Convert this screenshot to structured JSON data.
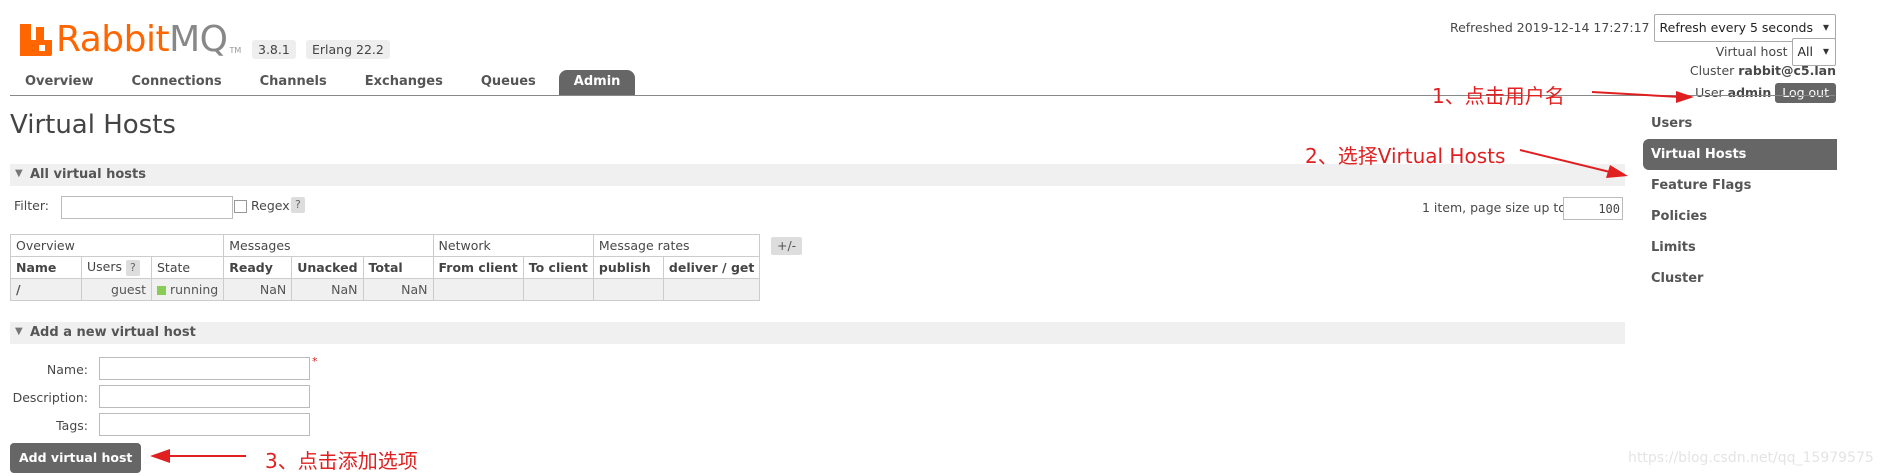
{
  "header": {
    "logo_brand": "Rabbit",
    "logo_mq": "MQ",
    "trademark": "TM",
    "version": "3.8.1",
    "erlang": "Erlang 22.2",
    "refreshed": "Refreshed 2019-12-14 17:27:17",
    "refresh_select": "Refresh every 5 seconds",
    "vhost_label": "Virtual host",
    "vhost_select": "All",
    "cluster_label": "Cluster",
    "cluster_name": "rabbit@c5.lan",
    "user_label": "User",
    "user_name": "admin",
    "logout_label": "Log out"
  },
  "tabs": [
    "Overview",
    "Connections",
    "Channels",
    "Exchanges",
    "Queues",
    "Admin"
  ],
  "right_menu": [
    "Users",
    "Virtual Hosts",
    "Feature Flags",
    "Policies",
    "Limits",
    "Cluster"
  ],
  "main": {
    "title": "Virtual Hosts",
    "section_all": "All virtual hosts",
    "filter_label": "Filter:",
    "regex_label": "Regex",
    "help_mark": "?",
    "paging_text": "1 item, page size up to",
    "page_size": "100",
    "plus_minus": "+/-",
    "table": {
      "groups": [
        "Overview",
        "Messages",
        "Network",
        "Message rates"
      ],
      "headers": [
        "Name",
        "Users",
        "State",
        "Ready",
        "Unacked",
        "Total",
        "From client",
        "To client",
        "publish",
        "deliver / get"
      ],
      "row": {
        "name": "/",
        "users": "guest",
        "state": "running",
        "ready": "NaN",
        "unacked": "NaN",
        "total": "NaN"
      }
    },
    "section_add": "Add a new virtual host",
    "name_label": "Name:",
    "description_label": "Description:",
    "tags_label": "Tags:",
    "required_mark": "*",
    "add_button": "Add virtual host"
  },
  "annotations": {
    "step1": "1、点击用户名",
    "step2": "2、选择Virtual Hosts",
    "step3": "3、点击添加选项"
  },
  "watermark": "https://blog.csdn.net/qq_15979575",
  "colors": {
    "brand_orange": "#ff6600",
    "accent_gray": "#666666",
    "annotation_red": "#e02020",
    "running_green": "#88cc55"
  }
}
